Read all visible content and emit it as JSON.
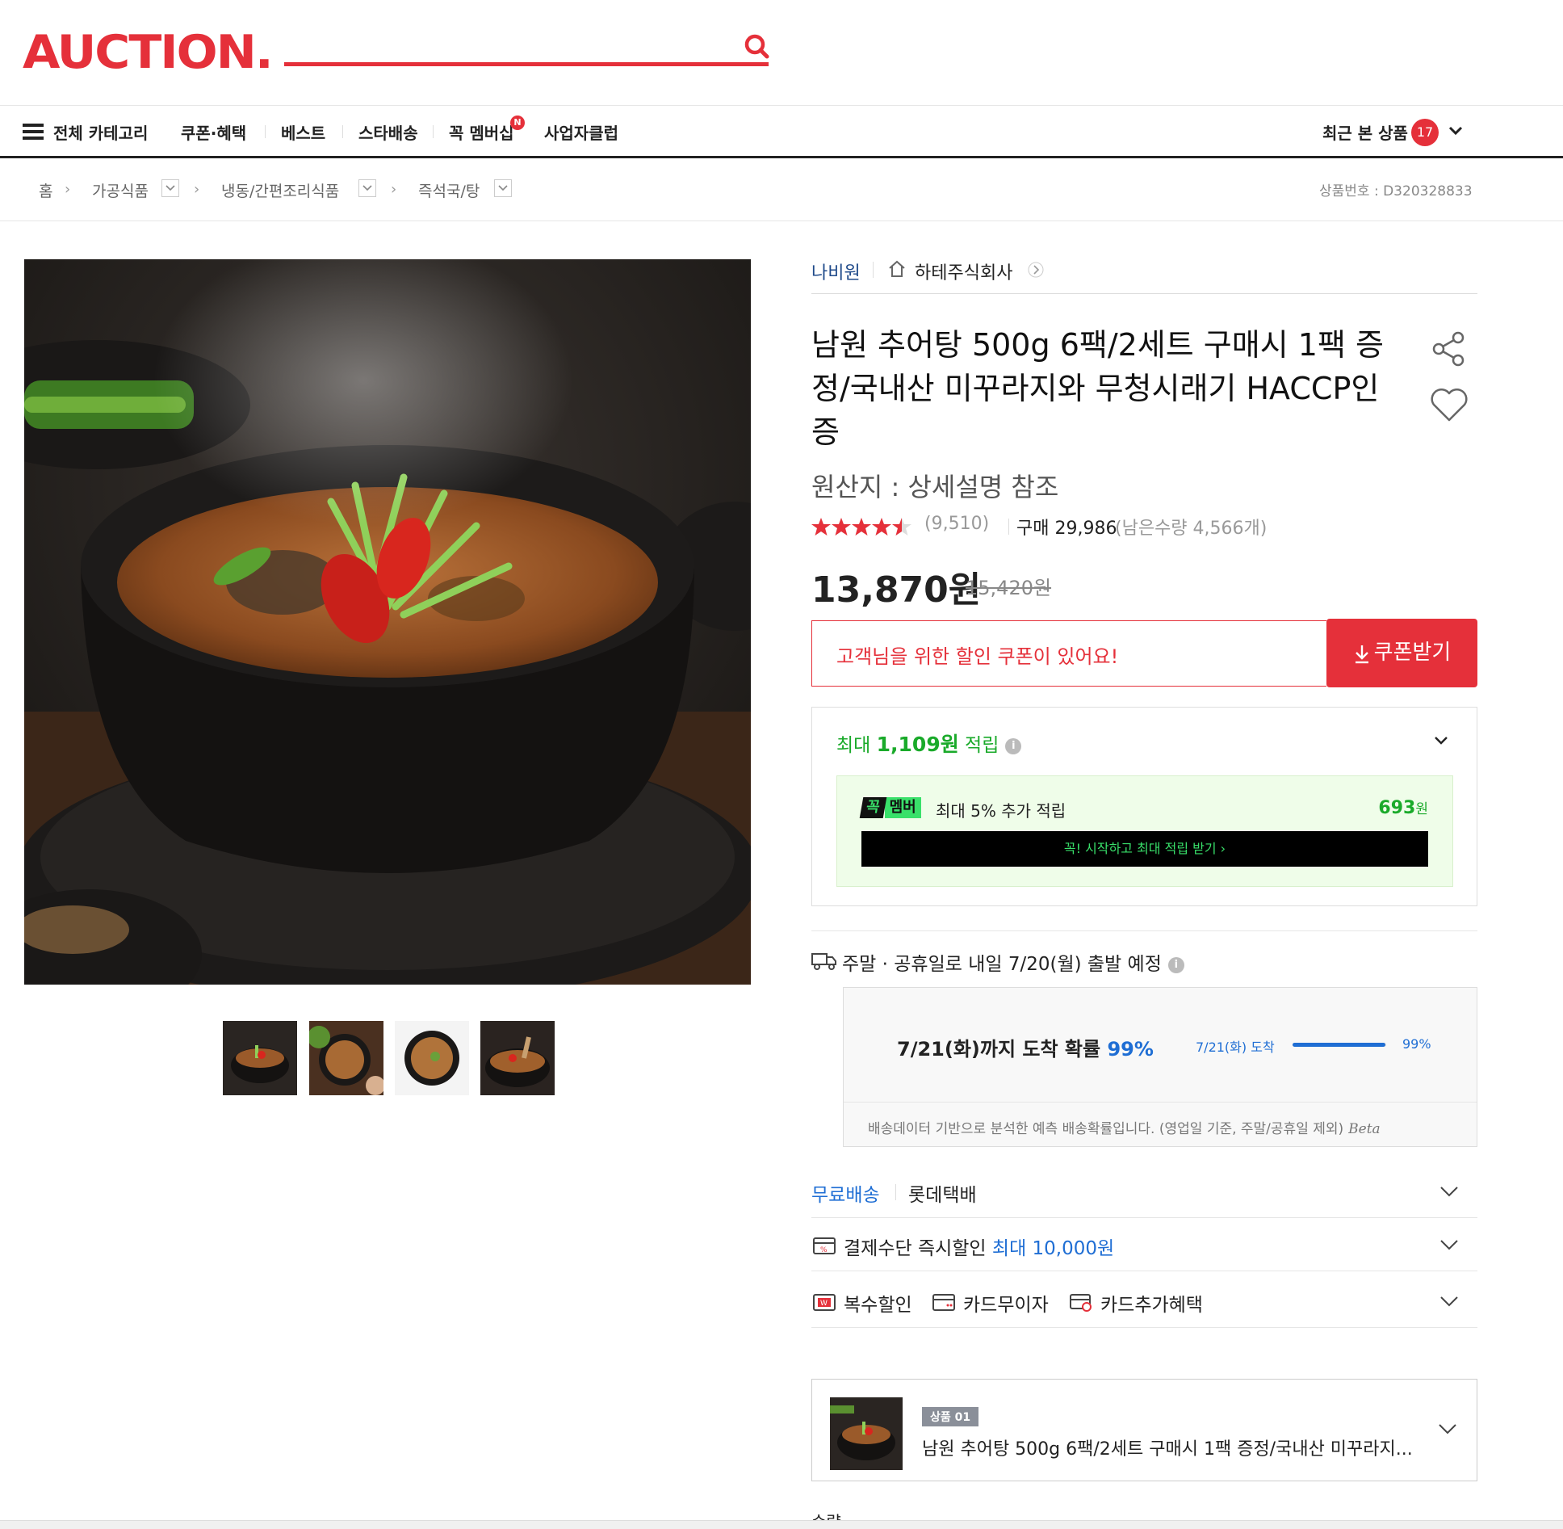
{
  "header": {
    "logo": "AUCTION.",
    "search_placeholder": ""
  },
  "nav": {
    "all_categories": "전체 카테고리",
    "items": [
      "쿠폰·혜택",
      "베스트",
      "스타배송",
      "꼭 멤버십",
      "사업자클럽"
    ],
    "new_badge": "N",
    "recent_label": "최근 본 상품",
    "recent_count": "17"
  },
  "breadcrumb": {
    "home": "홈",
    "levels": [
      "가공식품",
      "냉동/간편조리식품",
      "즉석국/탕"
    ],
    "product_no": "상품번호 : D320328833"
  },
  "seller": {
    "brand": "나비원",
    "store": "하테주식회사"
  },
  "product": {
    "title": "남원 추어탕 500g 6팩/2세트 구매시 1팩 증정/국내산 미꾸라지와 무청시래기 HACCP인증",
    "origin": "원산지 : 상세설명 참조",
    "rating": 4.5,
    "review_count": "(9,510)",
    "purchase_label": "구매 29,986",
    "remaining": "(남은수량 4,566개)",
    "price": "13,870원",
    "original_price": "15,420원"
  },
  "coupon": {
    "message": "고객님을 위한 할인 쿠폰이 있어요!",
    "button": "쿠폰받기"
  },
  "points": {
    "prefix": "최대 ",
    "amount": "1,109원",
    "suffix": " 적립",
    "member_badge_a": "꼭",
    "member_badge_b": "멤버",
    "member_text": "최대 5% 추가 적립",
    "member_points": "693",
    "member_unit": "원",
    "member_cta": "꼭! 시작하고 최대 적립 받기 ›"
  },
  "shipping": {
    "departure": "주말 · 공휴일로 내일 7/20(월) 출발 예정",
    "eta_text": "7/21(화)까지 도착 확률 ",
    "eta_pct": "99%",
    "eta_small": "7/21(화) 도착",
    "eta_small_pct": "99%",
    "eta_progress": 0.99,
    "note": "배송데이터 기반으로 분석한 예측 배송확률입니다. (영업일 기준, 주말/공휴일 제외)",
    "beta": "Beta"
  },
  "options": {
    "free_ship": "무료배송",
    "courier": "롯데택배",
    "pay_discount": "결제수단 즉시할인 ",
    "pay_discount_amt": "최대 10,000원",
    "multi_discount": "복수할인",
    "card_installment": "카드무이자",
    "card_benefit": "카드추가혜택"
  },
  "selected": {
    "tag": "상품 01",
    "name": "남원 추어탕 500g 6팩/2세트 구매시 1팩 증정/국내산 미꾸라지..."
  },
  "qty_label": "수량",
  "colors": {
    "brand_red": "#e5303a",
    "green": "#1aaa2a",
    "blue": "#1f6ed4"
  }
}
